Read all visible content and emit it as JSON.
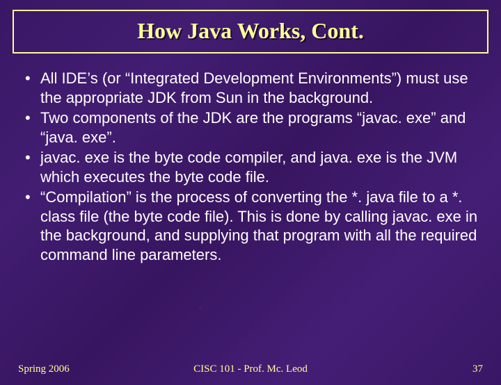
{
  "title": "How Java Works, Cont.",
  "bullets": [
    "All IDE’s (or “Integrated Development Environments”) must use the appropriate JDK from Sun in the background.",
    "Two components of the JDK are the programs “javac. exe” and “java. exe”.",
    "javac. exe is the byte code compiler, and java. exe is the JVM which executes the byte code file.",
    "“Compilation” is the process of converting the *. java file to a *. class file (the byte code file).  This is done by calling javac. exe in the background, and supplying that program with all the required command line parameters."
  ],
  "footer": {
    "left": "Spring 2006",
    "center": "CISC 101 - Prof. Mc. Leod",
    "right": "37"
  }
}
